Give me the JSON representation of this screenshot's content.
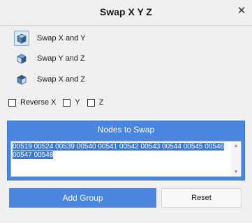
{
  "window": {
    "title": "Swap X Y Z",
    "close_icon": "close-icon"
  },
  "swap_options": [
    {
      "label": "Swap X and Y",
      "icon": "cube-icon",
      "selected": true
    },
    {
      "label": "Swap Y and Z",
      "icon": "cube-icon",
      "selected": false
    },
    {
      "label": "Swap X and Z",
      "icon": "cube-icon",
      "selected": false
    }
  ],
  "checkboxes": [
    {
      "label": "Reverse X",
      "checked": false
    },
    {
      "label": "Y",
      "checked": false
    },
    {
      "label": "Z",
      "checked": false
    }
  ],
  "nodes_group": {
    "header": "Nodes to Swap",
    "value": "00519 00524 00539 00540 00541 00542 00543 00544 00545 00546 00547 00548"
  },
  "buttons": {
    "add_group": "Add Group",
    "reset": "Reset"
  },
  "colors": {
    "accent": "#4a86e0",
    "selection": "#3a78d6",
    "background": "#f0f0f0"
  }
}
